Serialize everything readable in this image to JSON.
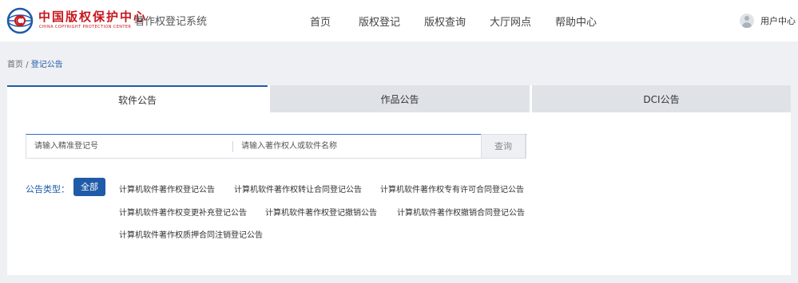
{
  "header": {
    "brand_cn": "中国版权保护中心",
    "brand_en": "CHINA COPYRIGHT PROTECTION CENTER",
    "system_title": "著作权登记系统",
    "nav": [
      "首页",
      "版权登记",
      "版权查询",
      "大厅网点",
      "帮助中心"
    ],
    "user_label": "用户中心"
  },
  "breadcrumb": {
    "home": "首页",
    "separator": "/",
    "current": "登记公告"
  },
  "tabs": [
    "软件公告",
    "作品公告",
    "DCI公告"
  ],
  "search": {
    "reg_placeholder": "请输入精准登记号",
    "name_placeholder": "请输入著作权人或软件名称",
    "button_label": "查询"
  },
  "filter": {
    "label": "公告类型：",
    "all_label": "全部",
    "types": [
      "计算机软件著作权登记公告",
      "计算机软件著作权转让合同登记公告",
      "计算机软件著作权专有许可合同登记公告",
      "计算机软件著作权变更补充登记公告",
      "计算机软件著作权登记撤销公告",
      "计算机软件著作权撤销合同登记公告",
      "计算机软件著作权质押合同注销登记公告"
    ]
  },
  "colors": {
    "accent": "#1f5ba8",
    "brand_red": "#c8161d"
  },
  "icons": {
    "logo": "cpcc-logo",
    "avatar": "user-avatar-icon"
  }
}
